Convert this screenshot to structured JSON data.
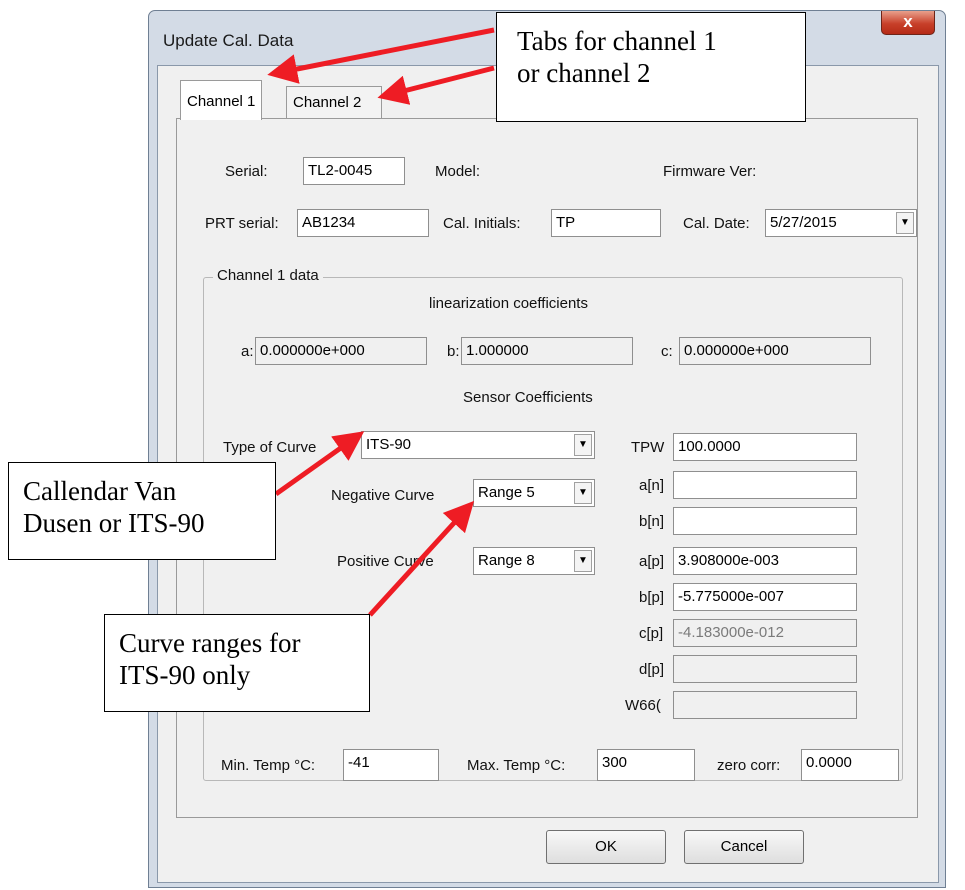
{
  "window": {
    "title": "Update Cal. Data",
    "close_label": "x"
  },
  "tabs": [
    {
      "label": "Channel 1",
      "active": true
    },
    {
      "label": "Channel 2",
      "active": false
    }
  ],
  "header": {
    "serial_label": "Serial:",
    "serial_value": "TL2-0045",
    "model_label": "Model:",
    "firmware_label": "Firmware Ver:",
    "prt_serial_label": "PRT serial:",
    "prt_serial_value": "AB1234",
    "cal_initials_label": "Cal. Initials:",
    "cal_initials_value": "TP",
    "cal_date_label": "Cal. Date:",
    "cal_date_value": "5/27/2015"
  },
  "channel_data": {
    "group_title": "Channel 1 data",
    "linearization_heading": "linearization coefficients",
    "a_label": "a:",
    "a_value": "0.000000e+000",
    "b_label": "b:",
    "b_value": "1.000000",
    "c_label": "c:",
    "c_value": "0.000000e+000",
    "sensor_heading": "Sensor Coefficients",
    "curve_type_label": "Type of Curve",
    "curve_type_value": "ITS-90",
    "negative_curve_label": "Negative Curve",
    "negative_curve_value": "Range 5",
    "positive_curve_label": "Positive Curve",
    "positive_curve_value": "Range 8",
    "coefficients": [
      {
        "label": "TPW",
        "value": "100.0000",
        "state": "normal"
      },
      {
        "label": "a[n]",
        "value": "",
        "state": "normal"
      },
      {
        "label": "b[n]",
        "value": "",
        "state": "normal"
      },
      {
        "label": "a[p]",
        "value": "3.908000e-003",
        "state": "normal"
      },
      {
        "label": "b[p]",
        "value": "-5.775000e-007",
        "state": "normal"
      },
      {
        "label": "c[p]",
        "value": "-4.183000e-012",
        "state": "disabled"
      },
      {
        "label": "d[p]",
        "value": "",
        "state": "disabled"
      },
      {
        "label": "W66(",
        "value": "",
        "state": "disabled"
      }
    ]
  },
  "footer": {
    "min_temp_label": "Min. Temp °C:",
    "min_temp_value": "-41",
    "max_temp_label": "Max. Temp °C:",
    "max_temp_value": "300",
    "zero_corr_label": "zero corr:",
    "zero_corr_value": "0.0000"
  },
  "buttons": {
    "ok_label": "OK",
    "cancel_label": "Cancel"
  },
  "callouts": {
    "tabs_line1": "Tabs for channel 1",
    "tabs_line2": "or channel 2",
    "curve_line1": "Callendar Van",
    "curve_line2": "Dusen or ITS-90",
    "ranges_line1": "Curve ranges for",
    "ranges_line2": "ITS-90 only"
  },
  "colors": {
    "annotation_arrow": "#ee1c24",
    "title_bar": "#d3dbe6",
    "close_button": "#c8402a"
  }
}
